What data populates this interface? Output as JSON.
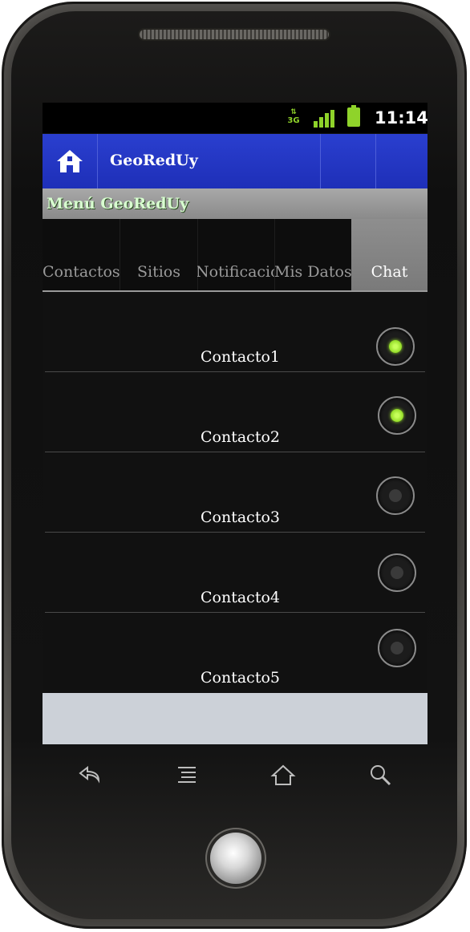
{
  "status_bar": {
    "network_label": "3G",
    "time": "11:14",
    "signal_icon": "signal-bars-icon",
    "battery_icon": "battery-icon"
  },
  "action_bar": {
    "home_icon": "home-icon",
    "title": "GeoRedUy"
  },
  "menu_header": {
    "title": "Menú GeoRedUy"
  },
  "tabs": [
    {
      "label": "Contactos",
      "active": false
    },
    {
      "label": "Sitios",
      "active": false
    },
    {
      "label": "Notificaciones",
      "active": false
    },
    {
      "label": "Mis Datos",
      "active": false
    },
    {
      "label": "Chat",
      "active": true
    }
  ],
  "contacts": [
    {
      "name": "Contacto1",
      "selected": true
    },
    {
      "name": "Contacto2",
      "selected": true
    },
    {
      "name": "Contacto3",
      "selected": false
    },
    {
      "name": "Contacto4",
      "selected": false
    },
    {
      "name": "Contacto5",
      "selected": false
    }
  ],
  "hardware_keys": [
    "back-icon",
    "menu-icon",
    "home-icon",
    "search-icon"
  ],
  "colors": {
    "action_bar": "#1e2fb8",
    "radio_on": "#7dcc12",
    "footer_panel": "#ccd1d8"
  }
}
